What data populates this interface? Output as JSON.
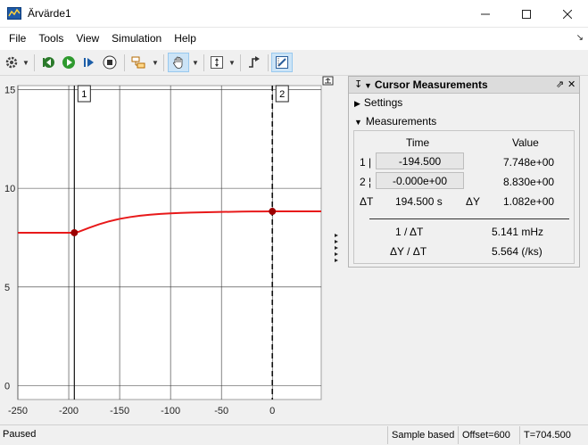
{
  "window": {
    "title": "Ärvärde1"
  },
  "menu": [
    "File",
    "Tools",
    "View",
    "Simulation",
    "Help"
  ],
  "plot": {
    "x_ticks": [
      "-250",
      "-200",
      "-150",
      "-100",
      "-50",
      "0"
    ],
    "y_ticks": [
      "15",
      "10",
      "5",
      "0"
    ],
    "xlim": [
      -250,
      48
    ],
    "ylim": [
      -0.7,
      15.2
    ],
    "line_color": "#e8191a",
    "marker_color": "#9b0000",
    "cursor1": {
      "tag": "1",
      "x": -194.5,
      "y": 7.748
    },
    "cursor2": {
      "tag": "2",
      "x": 0,
      "y": 8.83
    }
  },
  "chart_data": {
    "type": "line",
    "title": "",
    "xlabel": "",
    "ylabel": "",
    "xlim": [
      -250,
      48
    ],
    "ylim": [
      -0.7,
      15.2
    ],
    "series": [
      {
        "x": [
          -250,
          -225,
          -200,
          -194.5,
          -190,
          -180,
          -170,
          -160,
          -150,
          -140,
          -130,
          -120,
          -110,
          -100,
          -90,
          -80,
          -70,
          -60,
          -50,
          -40,
          -30,
          -20,
          -10,
          0,
          10,
          20,
          30,
          40,
          48
        ],
        "values": [
          7.748,
          7.748,
          7.748,
          7.748,
          7.8,
          8.0,
          8.18,
          8.33,
          8.45,
          8.54,
          8.61,
          8.66,
          8.7,
          8.73,
          8.75,
          8.77,
          8.78,
          8.79,
          8.8,
          8.81,
          8.82,
          8.825,
          8.828,
          8.83,
          8.83,
          8.83,
          8.83,
          8.83,
          8.83
        ]
      }
    ]
  },
  "panel": {
    "title": "Cursor Measurements",
    "settings_label": "Settings",
    "measurements_label": "Measurements",
    "col_time": "Time",
    "col_value": "Value",
    "row1_label": "1",
    "row1_time": "-194.500",
    "row1_value": "7.748e+00",
    "row2_label": "2",
    "row2_time": "-0.000e+00",
    "row2_value": "8.830e+00",
    "dt_label": "ΔT",
    "dt_value": "194.500 s",
    "dy_label": "ΔY",
    "dy_value": "1.082e+00",
    "inv_dt_label": "1 / ΔT",
    "inv_dt_value": "5.141 mHz",
    "slope_label": "ΔY / ΔT",
    "slope_value": "5.564 (/ks)"
  },
  "status": {
    "state": "Paused",
    "mode": "Sample based",
    "offset": "Offset=600",
    "time": "T=704.500"
  }
}
